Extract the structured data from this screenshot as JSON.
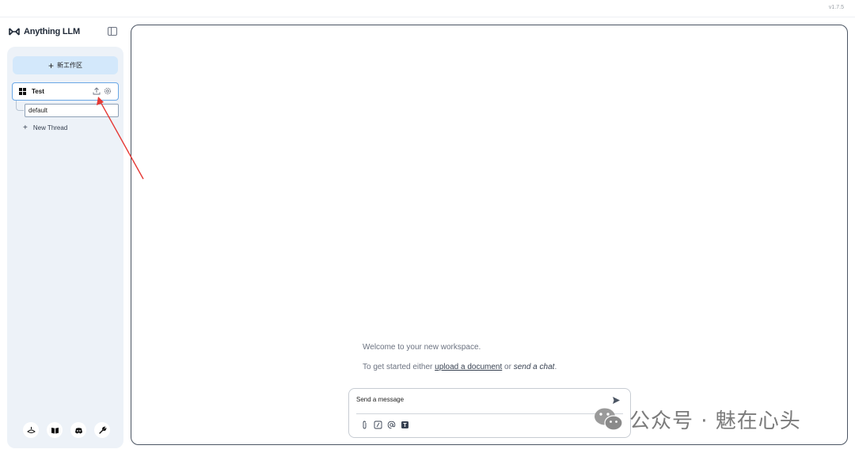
{
  "app": {
    "name": "Anything LLM",
    "version": "v1.7.5"
  },
  "sidebar": {
    "new_workspace_label": "新工作区",
    "workspaces": [
      {
        "name": "Test",
        "threads": [
          {
            "name": "default"
          }
        ],
        "new_thread_label": "New Thread"
      }
    ],
    "footer_icons": [
      "community-hub-icon",
      "docs-book-icon",
      "discord-icon",
      "settings-wrench-icon"
    ]
  },
  "main": {
    "welcome_line1": "Welcome to your new workspace.",
    "welcome_line2_prefix": "To get started either",
    "welcome_link_upload": "upload a document",
    "welcome_or": "or",
    "welcome_send_chat": "send a chat",
    "welcome_period": "."
  },
  "composer": {
    "placeholder": "Send a message",
    "tools": [
      "attach-icon",
      "slash-command-icon",
      "at-mention-icon",
      "text-size-icon"
    ],
    "send_icon": "send-icon",
    "mic_icon": "microphone-icon"
  },
  "overlay": {
    "watermark_text": "公众号 · 魅在心头",
    "annotation_arrow_color": "#e53935"
  },
  "colors": {
    "accent_light": "#d3e8fb",
    "selected_border": "#6aa7e6",
    "sidebar_bg": "#edf2f8"
  }
}
